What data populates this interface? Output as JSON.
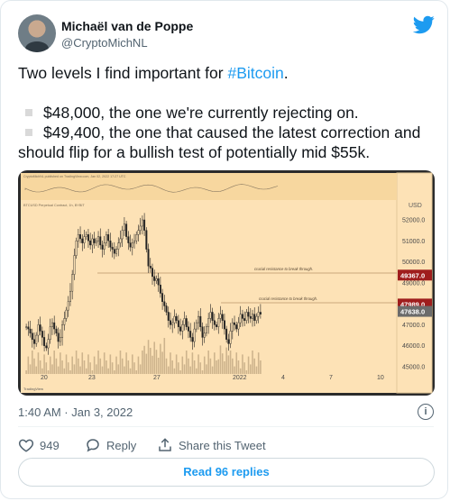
{
  "author": {
    "name": "Michaël van de Poppe",
    "handle": "@CryptoMichNL"
  },
  "tweet": {
    "intro_prefix": "Two levels I find important for ",
    "intro_hashtag": "#Bitcoin",
    "intro_suffix": ".",
    "bullet1": "$48,000, the one we're currently rejecting on.",
    "bullet2_line1": "$49,400, the one that caused the latest correction and",
    "bullet2_line2": "should flip for a bullish test of potentially mid $55k."
  },
  "chart_data": {
    "type": "candlestick",
    "title": "BTCUSD Perpetual Contract, 1h, BYBIT",
    "currency": "USD",
    "y_ticks": [
      "52000.0",
      "51000.0",
      "50000.0",
      "49000.0",
      "48000.0",
      "47000.0",
      "46000.0",
      "45000.0"
    ],
    "x_ticks": [
      "20",
      "23",
      "27",
      "2022",
      "4",
      "7",
      "10"
    ],
    "price_tags": [
      {
        "value": "49367.0",
        "color": "#9f1d1d"
      },
      {
        "value": "47989.0",
        "color": "#9f1d1d"
      },
      {
        "value": "47638.0",
        "color": "#6b6b6b"
      }
    ],
    "annotations": [
      "crucial resistance to break through.",
      "crucial resistance to break through."
    ],
    "header_text": "CryptoMichNL published on TradingView.com, Jan 02, 2022 17:27 UTC",
    "watermark": "TradingView"
  },
  "meta": {
    "timestamp": "1:40 AM · Jan 3, 2022"
  },
  "actions": {
    "likes": "949",
    "reply": "Reply",
    "share": "Share this Tweet",
    "read_replies": "Read 96 replies"
  }
}
